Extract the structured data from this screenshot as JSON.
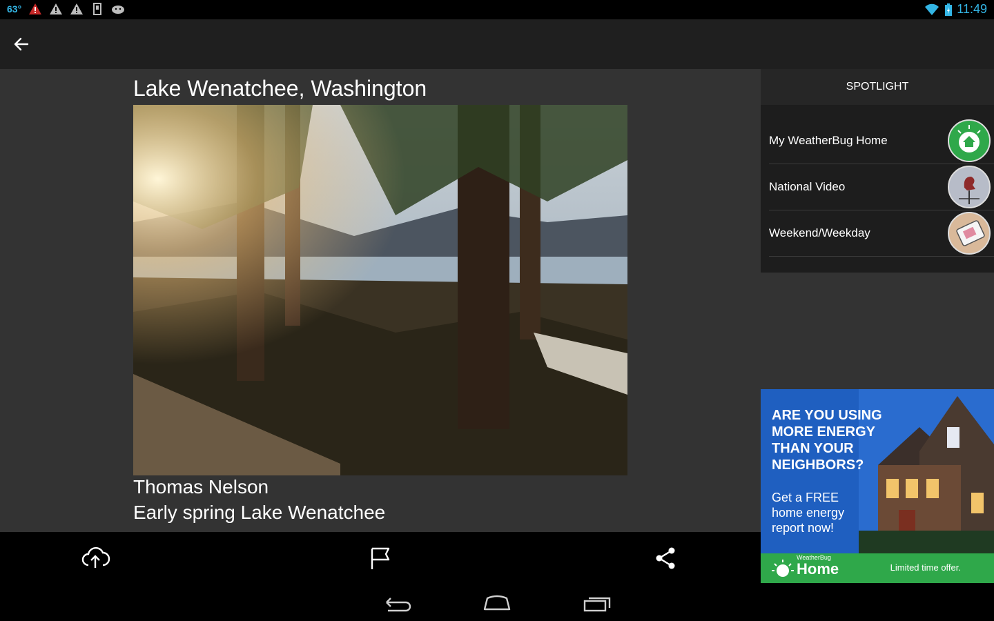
{
  "status_bar": {
    "temperature": "63°",
    "icons": [
      "alert-red-icon",
      "warning-icon",
      "warning-icon",
      "storage-icon",
      "android-icon"
    ],
    "right_icons": [
      "wifi-icon",
      "battery-icon"
    ],
    "time": "11:49"
  },
  "action_bar": {
    "back_icon": "arrow-left-icon"
  },
  "photo": {
    "title": "Lake Wenatchee, Washington",
    "author": "Thomas Nelson",
    "description": "Early spring Lake Wenatchee"
  },
  "spotlight": {
    "header": "SPOTLIGHT",
    "items": [
      {
        "label": "My WeatherBug Home",
        "thumb_icon": "weatherbug-home-icon"
      },
      {
        "label": "National Video",
        "thumb_icon": "weathervane-icon"
      },
      {
        "label": "Weekend/Weekday",
        "thumb_icon": "tablet-hands-icon"
      }
    ]
  },
  "ad": {
    "headline": "ARE YOU USING MORE ENERGY THAN YOUR NEIGHBORS?",
    "subtext": "Get a FREE home energy report now!",
    "brand_small": "WeatherBug",
    "brand": "Home",
    "offer": "Limited time offer."
  },
  "toolbar": {
    "buttons": [
      "cloud-upload-icon",
      "flag-icon",
      "share-icon"
    ]
  },
  "nav_bar": {
    "buttons": [
      "back-nav-icon",
      "home-nav-icon",
      "recents-nav-icon"
    ]
  },
  "colors": {
    "accent": "#33b5e5",
    "main_bg": "#333333",
    "sidebar_bg": "#1d1d1d",
    "ad_blue": "#1f5fc0",
    "ad_green": "#2fa84a"
  }
}
